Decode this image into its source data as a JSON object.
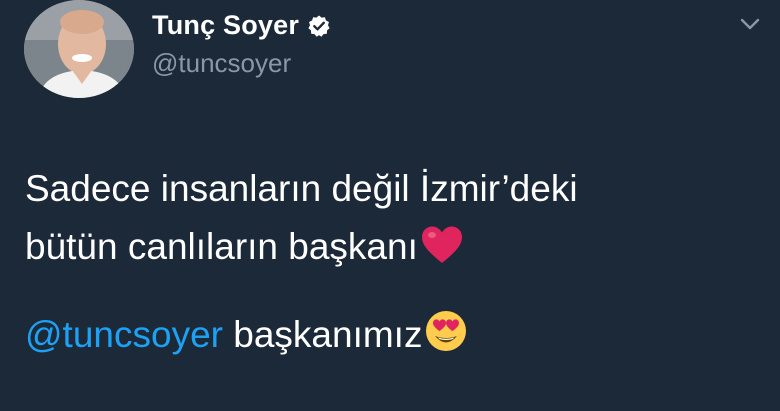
{
  "tweet": {
    "author": {
      "display_name": "Tunç Soyer",
      "handle": "@tuncsoyer",
      "verified": true
    },
    "text_lines": [
      "Sadece insanların değil İzmir’deki",
      "bütün canlıların başkanı"
    ],
    "reply": {
      "mention": "@tuncsoyer",
      "text": " başkanımız"
    },
    "icons": {
      "verified": "verified-badge-icon",
      "menu": "chevron-down-icon",
      "heart": "red-heart-emoji",
      "heart_eyes": "heart-eyes-emoji"
    },
    "colors": {
      "background": "#1c2938",
      "name": "#ffffff",
      "handle": "#8899a6",
      "mention": "#1da1f2",
      "heart": "#e0245e"
    }
  }
}
